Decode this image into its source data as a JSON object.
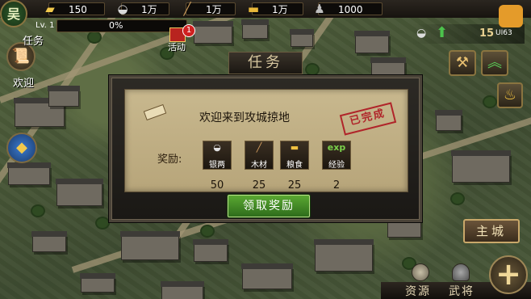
{
  "faction": "吴",
  "level": "Lv. 1",
  "xp_percent": "0%",
  "resources": [
    {
      "icon": "gold-ingot-icon",
      "value": "150"
    },
    {
      "icon": "silver-ingot-icon",
      "value": "1万"
    },
    {
      "icon": "wood-icon",
      "value": "1万"
    },
    {
      "icon": "grain-icon",
      "value": "1万"
    },
    {
      "icon": "soldier-icon",
      "value": "1000"
    }
  ],
  "activity": {
    "label": "活动",
    "badge": "1"
  },
  "quest_button": {
    "label": "任务",
    "sub": "欢迎"
  },
  "power_value": "15",
  "brand_logo": "UI63",
  "dialog": {
    "title": "任务",
    "quest_name": "欢迎来到攻城掠地",
    "completed_stamp": "已完成",
    "reward_label": "奖励:",
    "rewards": [
      {
        "name": "银两",
        "icon": "silver-ingot-icon",
        "value": "50"
      },
      {
        "name": "木材",
        "icon": "wood-icon",
        "value": "25"
      },
      {
        "name": "粮食",
        "icon": "grain-icon",
        "value": "25"
      },
      {
        "name": "经验",
        "icon": "exp-icon",
        "icon_text": "exp",
        "value": "2"
      }
    ],
    "claim_button": "领取奖励"
  },
  "main_city": "主城",
  "bottom_tabs": [
    "资源",
    "武将"
  ],
  "colors": {
    "claim_green": "#4a9a2a",
    "stamp_red": "#b0252a",
    "panel": "#bfae84"
  }
}
